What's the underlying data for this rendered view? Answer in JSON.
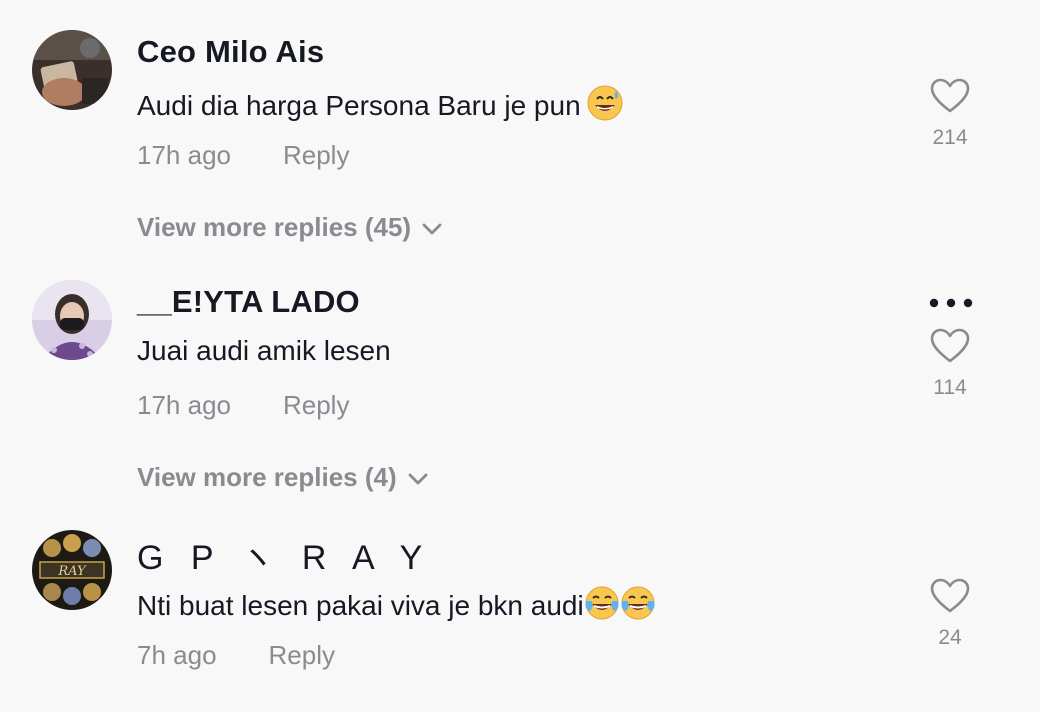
{
  "comments": [
    {
      "username": "Ceo Milo Ais",
      "text": "Audi dia harga Persona Baru je pun",
      "emoji": "grinning-sweat-emoji",
      "time": "17h ago",
      "reply_label": "Reply",
      "likes": "214",
      "view_more": "View more replies (45)"
    },
    {
      "username": "__E!YTA LADO",
      "text": "Juai audi amik lesen",
      "time": "17h ago",
      "reply_label": "Reply",
      "likes": "114",
      "view_more": "View more replies (4)",
      "has_more_menu": true
    },
    {
      "username": "G P ヽ R A Y",
      "text": "Nti buat lesen pakai viva je bkn audi",
      "emoji": "tears-of-joy-emoji",
      "emoji_count": 2,
      "time": "7h ago",
      "reply_label": "Reply",
      "likes": "24"
    }
  ],
  "icons": {
    "like": "heart-outline-icon",
    "expand": "chevron-down-icon",
    "more": "more-horizontal-icon"
  },
  "colors": {
    "background": "#f8f8f8",
    "primary_text": "#161823",
    "secondary_text": "#8a8b91"
  }
}
